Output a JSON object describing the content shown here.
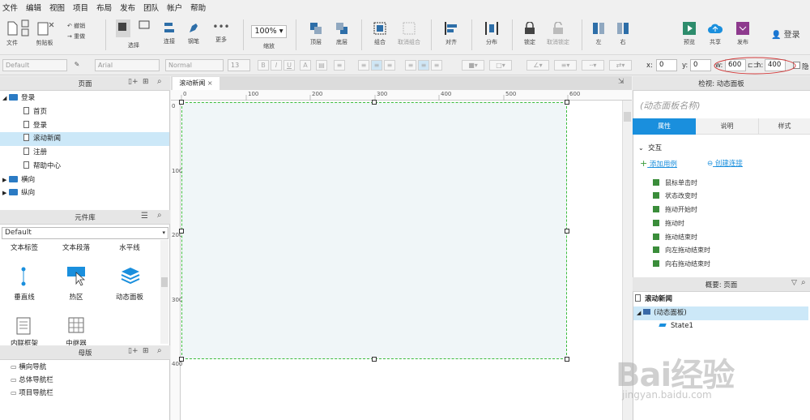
{
  "menu": [
    "文件",
    "编辑",
    "视图",
    "项目",
    "布局",
    "发布",
    "团队",
    "帐户",
    "帮助"
  ],
  "toolbar": {
    "file": "文件",
    "clipboard": "剪贴板",
    "cut_label": "撤销",
    "redo_label": "重做",
    "select": "选择",
    "connect": "连接",
    "pen": "钢笔",
    "more": "更多",
    "zoom_value": "100%",
    "zoom_label": "缩放",
    "top": "顶层",
    "bottom": "底层",
    "group": "组合",
    "ungroup": "取消组合",
    "align": "对齐",
    "distribute": "分布",
    "lock": "锁定",
    "unlock": "取消锁定",
    "left": "左",
    "right": "右",
    "preview": "预览",
    "share": "共享",
    "publish": "发布",
    "login": "登录"
  },
  "format": {
    "style": "Default",
    "font": "Arial",
    "weight": "Normal",
    "size": "13",
    "x_label": "x:",
    "x": "0",
    "y_label": "y:",
    "y": "0",
    "w_label": "w:",
    "w": "600",
    "h_label": "h:",
    "h": "400",
    "hide": "隐"
  },
  "pages_panel": {
    "title": "页面",
    "items": [
      {
        "label": "登录",
        "type": "folder",
        "level": 0
      },
      {
        "label": "首页",
        "type": "page",
        "level": 1
      },
      {
        "label": "登录",
        "type": "page",
        "level": 1
      },
      {
        "label": "滚动新闻",
        "type": "page",
        "level": 1,
        "selected": true
      },
      {
        "label": "注册",
        "type": "page",
        "level": 1
      },
      {
        "label": "帮助中心",
        "type": "page",
        "level": 1
      },
      {
        "label": "横向",
        "type": "folder",
        "level": 0
      },
      {
        "label": "纵向",
        "type": "folder",
        "level": 0
      }
    ]
  },
  "library_panel": {
    "title": "元件库",
    "selected": "Default",
    "row1": [
      "文本标签",
      "文本段落",
      "水平线"
    ],
    "row2": [
      "垂直线",
      "热区",
      "动态面板"
    ],
    "row3": [
      "内联框架",
      "中继器"
    ]
  },
  "masters_panel": {
    "title": "母版",
    "items": [
      "横向导航",
      "总体导航栏",
      "项目导航栏"
    ]
  },
  "canvas": {
    "tab": "滚动新闻",
    "ruler_h": [
      "0",
      "100",
      "200",
      "300",
      "400",
      "500",
      "600"
    ],
    "ruler_v": [
      "0",
      "100",
      "200",
      "300",
      "400"
    ]
  },
  "inspector": {
    "title": "检视: 动态面板",
    "name_placeholder": "(动态面板名称)",
    "tabs": [
      "属性",
      "说明",
      "样式"
    ],
    "section": "交互",
    "add_case": "添加用例",
    "create_link": "创建连接",
    "events": [
      "鼠标单击时",
      "状态改变时",
      "拖动开始时",
      "拖动时",
      "拖动结束时",
      "向左拖动结束时",
      "向右拖动结束时"
    ]
  },
  "outline": {
    "title": "概要: 页面",
    "page": "滚动新闻",
    "panel": "(动态面板)",
    "state": "State1"
  },
  "watermark": {
    "main": "Bai经验",
    "sub": "jingyan.baidu.com"
  },
  "colors": {
    "accent": "#1a8fdd",
    "selection": "#cce8f8",
    "canvas_fill": "#f0f6f8"
  }
}
